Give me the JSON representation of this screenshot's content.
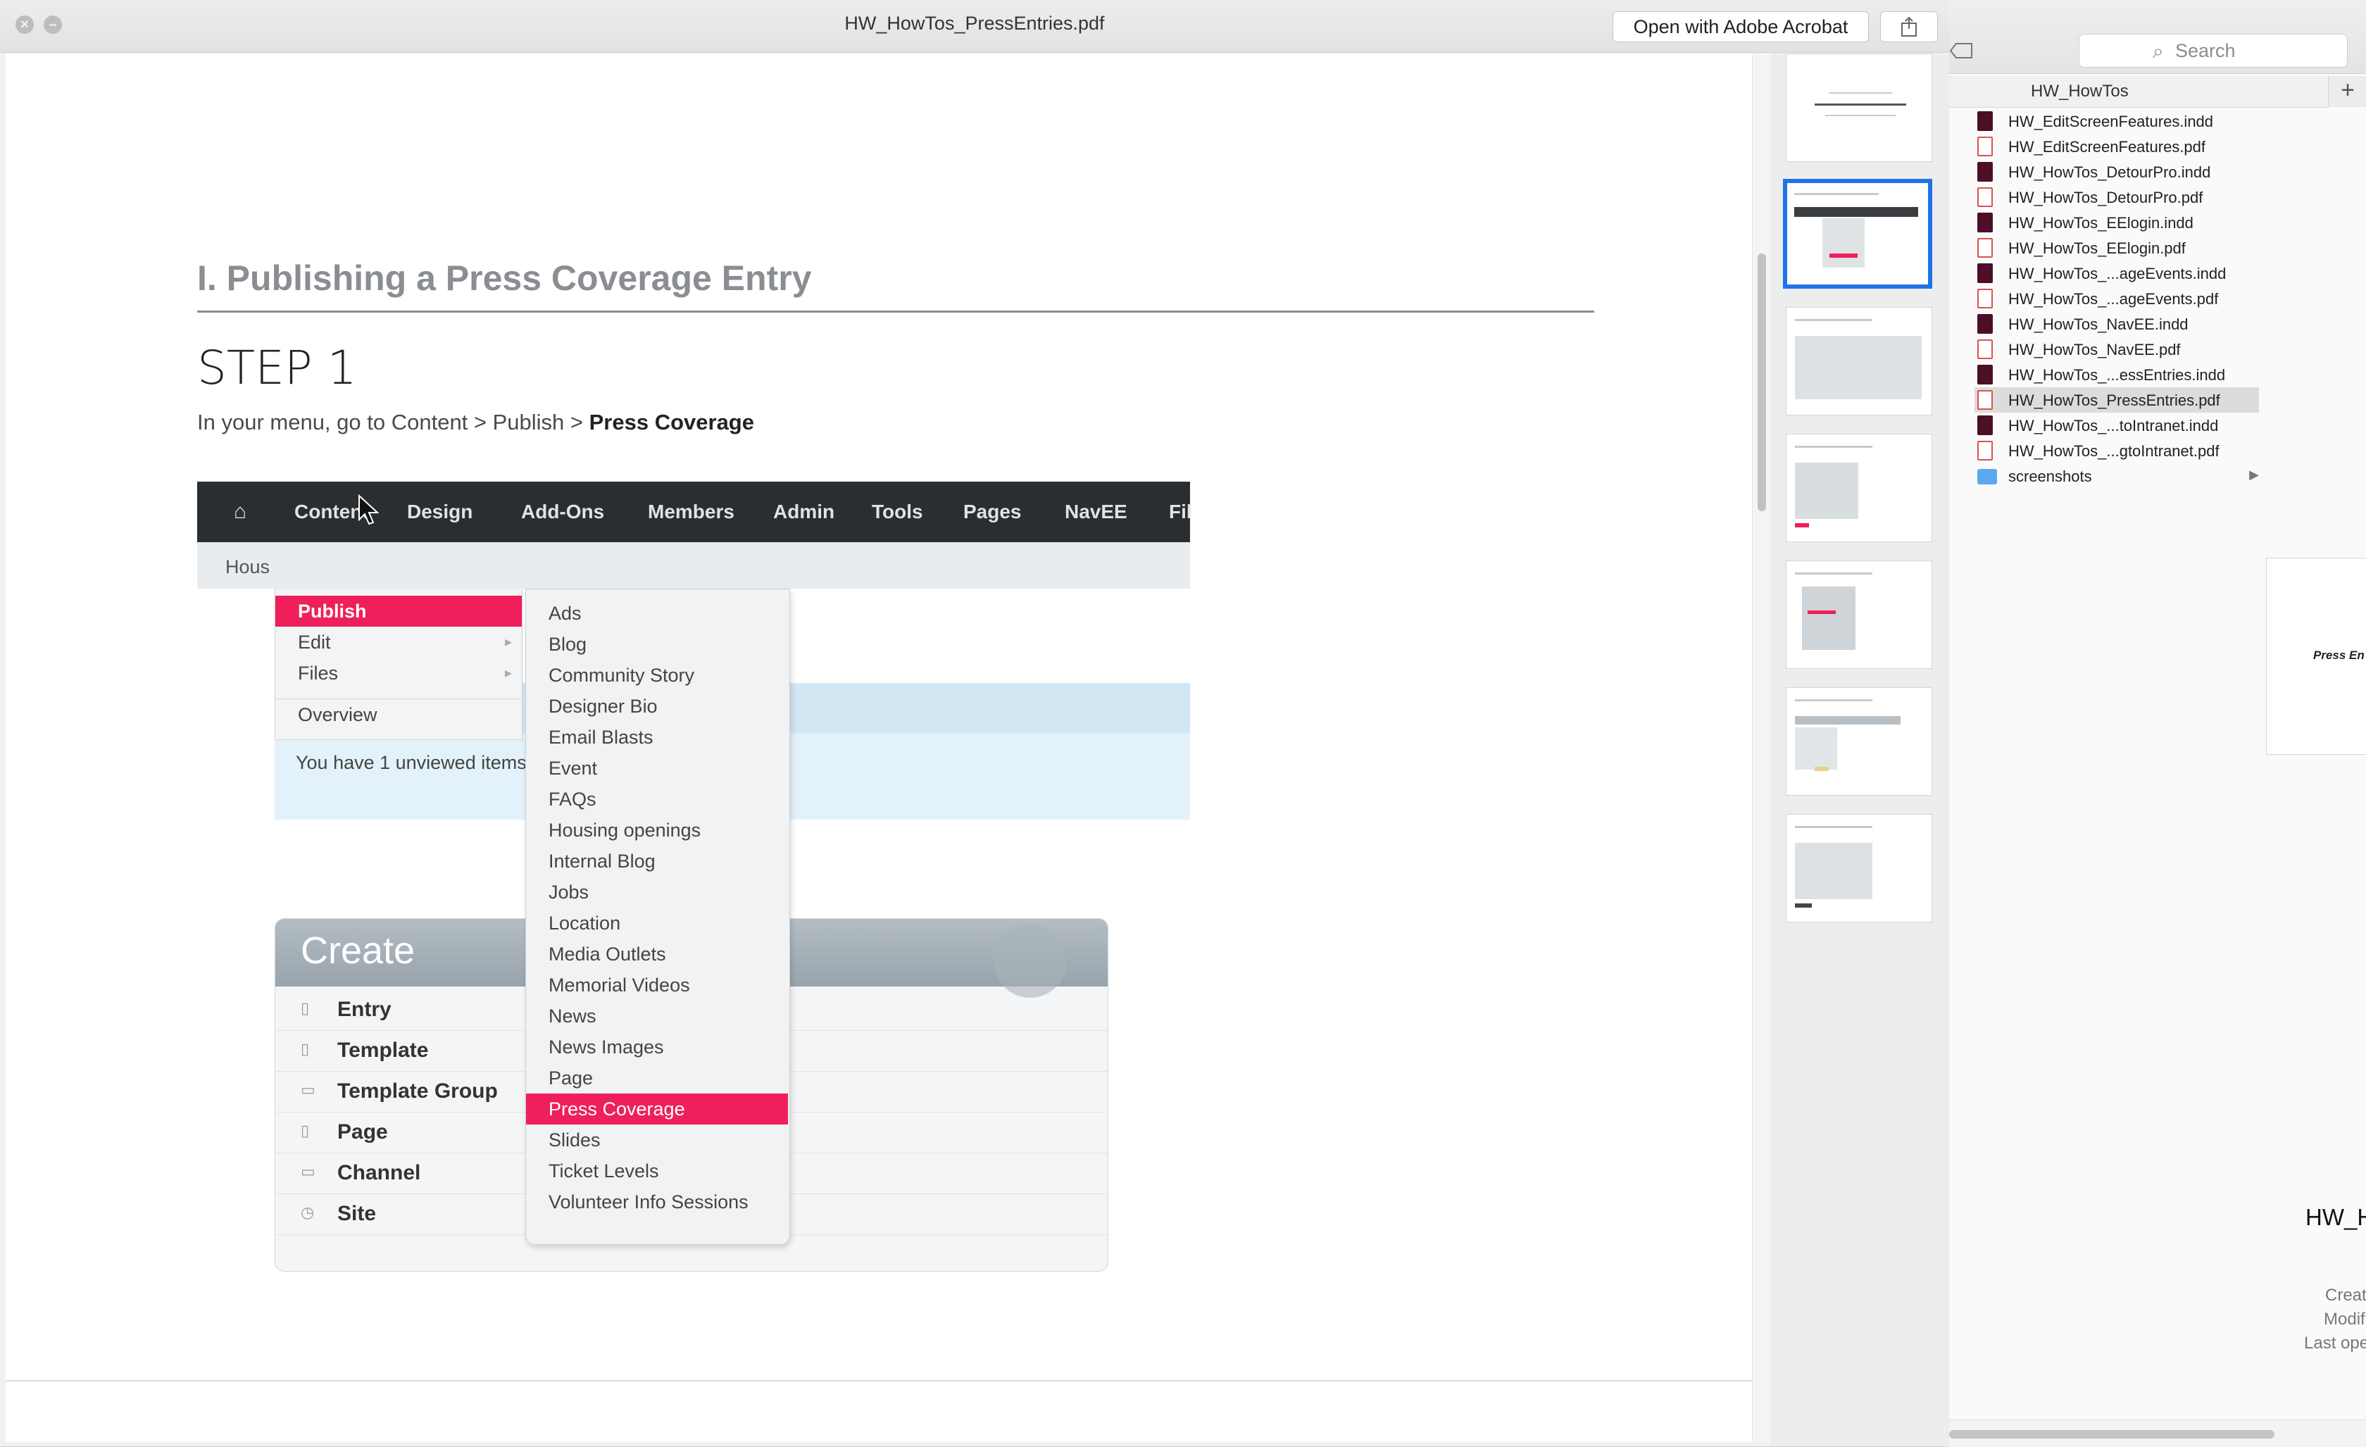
{
  "window": {
    "title": "HW_HowTos_PressEntries.pdf",
    "open_button": "Open with Adobe Acrobat"
  },
  "document": {
    "section_heading": "I. Publishing a Press Coverage Entry",
    "step_title": "STEP 1",
    "instruction_prefix": "In your menu, go to Content > Publish > ",
    "instruction_bold": "Press Coverage"
  },
  "ee_screenshot": {
    "nav": [
      "Content",
      "Design",
      "Add-Ons",
      "Members",
      "Admin",
      "Tools",
      "Pages",
      "NavEE",
      "Fil"
    ],
    "crumb": "Hous",
    "main_menu": [
      "Publish",
      "Edit",
      "Files",
      "Overview"
    ],
    "sub_menu": [
      "Ads",
      "Blog",
      "Community Story",
      "Designer Bio",
      "Email Blasts",
      "Event",
      "FAQs",
      "Housing openings",
      "Internal Blog",
      "Jobs",
      "Location",
      "Media Outlets",
      "Memorial Videos",
      "News",
      "News Images",
      "Page",
      "Press Coverage",
      "Slides",
      "Ticket Levels",
      "Volunteer Info Sessions"
    ],
    "notice": "You have 1 unviewed items",
    "create_title": "Create",
    "create_items": [
      "Entry",
      "Template",
      "Template Group",
      "Page",
      "Channel",
      "Site"
    ]
  },
  "finder": {
    "search_placeholder": "Search",
    "column_title": "HW_HowTos",
    "files": [
      {
        "name": "HW_EditScreenFeatures.indd",
        "type": "indd"
      },
      {
        "name": "HW_EditScreenFeatures.pdf",
        "type": "pdf"
      },
      {
        "name": "HW_HowTos_DetourPro.indd",
        "type": "indd"
      },
      {
        "name": "HW_HowTos_DetourPro.pdf",
        "type": "pdf"
      },
      {
        "name": "HW_HowTos_EElogin.indd",
        "type": "indd"
      },
      {
        "name": "HW_HowTos_EElogin.pdf",
        "type": "pdf"
      },
      {
        "name": "HW_HowTos_...ageEvents.indd",
        "type": "indd"
      },
      {
        "name": "HW_HowTos_...ageEvents.pdf",
        "type": "pdf"
      },
      {
        "name": "HW_HowTos_NavEE.indd",
        "type": "indd"
      },
      {
        "name": "HW_HowTos_NavEE.pdf",
        "type": "pdf"
      },
      {
        "name": "HW_HowTos_...essEntries.indd",
        "type": "indd"
      },
      {
        "name": "HW_HowTos_PressEntries.pdf",
        "type": "pdf",
        "selected": true
      },
      {
        "name": "HW_HowTos_...toIntranet.indd",
        "type": "indd"
      },
      {
        "name": "HW_HowTos_...gtoIntranet.pdf",
        "type": "pdf"
      },
      {
        "name": "screenshots",
        "type": "folder"
      }
    ],
    "preview_card_text": "Press En",
    "preview_name": "HW_How",
    "meta": [
      "Create",
      "Modifie",
      "Last opene"
    ]
  },
  "colors": {
    "accent_pink": "#ee1f5a",
    "selection_blue": "#1f73e8",
    "nav_dark": "#2b2e31"
  }
}
